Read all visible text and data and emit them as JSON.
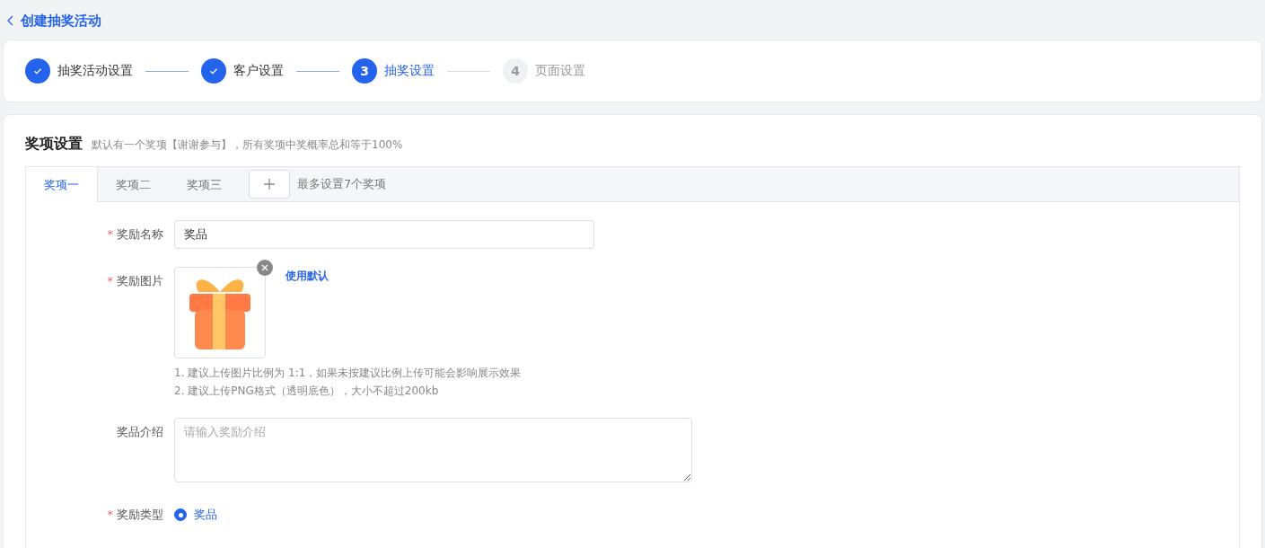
{
  "header": {
    "back_label": "创建抽奖活动"
  },
  "steps": [
    {
      "label": "抽奖活动设置",
      "done": true
    },
    {
      "label": "客户设置",
      "done": true
    },
    {
      "number": "3",
      "label": "抽奖设置",
      "done": false,
      "active": true
    },
    {
      "number": "4",
      "label": "页面设置",
      "done": false,
      "active": false
    }
  ],
  "section": {
    "title": "奖项设置",
    "hint": "默认有一个奖项【谢谢参与】，所有奖项中奖概率总和等于100%"
  },
  "tabs": [
    {
      "label": "奖项一",
      "selected": true
    },
    {
      "label": "奖项二",
      "selected": false
    },
    {
      "label": "奖项三",
      "selected": false
    }
  ],
  "add_hint": "最多设置7个奖项",
  "fields": [
    {
      "kind": "text",
      "label": "奖励名称",
      "required_mark": "*",
      "value": "奖品"
    },
    {
      "kind": "image",
      "label": "奖励图片",
      "required_mark": "*",
      "link": "使用默认",
      "notes": [
        "1. 建议上传图片比例为 1:1，如果未按建议比例上传可能会影响展示效果",
        "2. 建议上传PNG格式（透明底色），大小不超过200kb"
      ]
    },
    {
      "kind": "textarea",
      "label": "奖品介绍",
      "placeholder": "请输入奖励介绍"
    },
    {
      "kind": "radio",
      "label": "奖励类型",
      "required_mark": "*",
      "options": [
        {
          "label": "奖品",
          "selected": true
        }
      ]
    }
  ]
}
